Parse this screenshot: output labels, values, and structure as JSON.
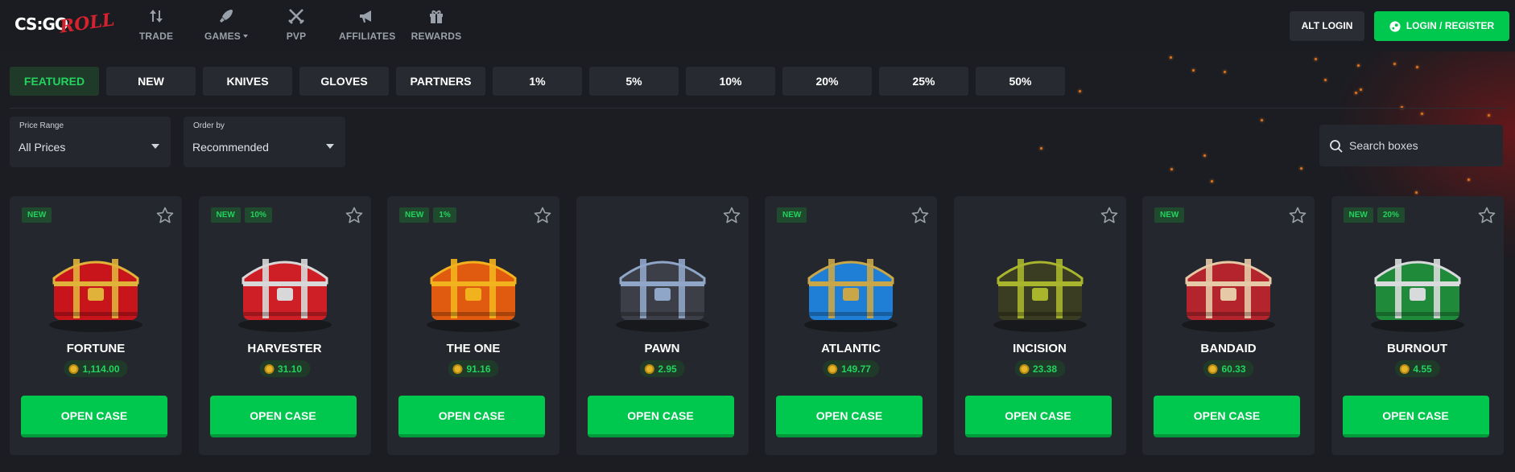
{
  "header": {
    "logo_text": "CS:GO",
    "logo_accent": "ROLL",
    "nav": [
      {
        "label": "TRADE",
        "icon": "arrows-up-down-icon"
      },
      {
        "label": "GAMES",
        "icon": "rocket-icon",
        "has_dropdown": true
      },
      {
        "label": "PVP",
        "icon": "crossed-swords-icon"
      },
      {
        "label": "AFFILIATES",
        "icon": "megaphone-icon"
      },
      {
        "label": "REWARDS",
        "icon": "gift-icon"
      }
    ],
    "alt_login_label": "ALT LOGIN",
    "login_label": "LOGIN / REGISTER"
  },
  "tabs": [
    {
      "label": "FEATURED",
      "active": true
    },
    {
      "label": "NEW"
    },
    {
      "label": "KNIVES"
    },
    {
      "label": "GLOVES"
    },
    {
      "label": "PARTNERS"
    },
    {
      "label": "1%"
    },
    {
      "label": "5%"
    },
    {
      "label": "10%"
    },
    {
      "label": "20%"
    },
    {
      "label": "25%"
    },
    {
      "label": "50%"
    }
  ],
  "filters": {
    "price_range": {
      "label": "Price Range",
      "value": "All Prices"
    },
    "order_by": {
      "label": "Order by",
      "value": "Recommended"
    },
    "search": {
      "placeholder": "Search boxes"
    }
  },
  "cases": [
    {
      "name": "FORTUNE",
      "price": "1,114.00",
      "badges": [
        "NEW"
      ],
      "colors": [
        "#c8141b",
        "#e0b23a"
      ]
    },
    {
      "name": "HARVESTER",
      "price": "31.10",
      "badges": [
        "NEW",
        "10%"
      ],
      "colors": [
        "#cf1f26",
        "#d8d8d8"
      ]
    },
    {
      "name": "THE ONE",
      "price": "91.16",
      "badges": [
        "NEW",
        "1%"
      ],
      "colors": [
        "#e05a10",
        "#f2b21e"
      ]
    },
    {
      "name": "PAWN",
      "price": "2.95",
      "badges": [],
      "colors": [
        "#3c3f47",
        "#8fa6c8"
      ]
    },
    {
      "name": "ATLANTIC",
      "price": "149.77",
      "badges": [
        "NEW"
      ],
      "colors": [
        "#1f7fd6",
        "#c9a648"
      ]
    },
    {
      "name": "INCISION",
      "price": "23.38",
      "badges": [],
      "colors": [
        "#3a3d22",
        "#a9b52c"
      ]
    },
    {
      "name": "BANDAID",
      "price": "60.33",
      "badges": [
        "NEW"
      ],
      "colors": [
        "#b3242c",
        "#e6c9a6"
      ]
    },
    {
      "name": "BURNOUT",
      "price": "4.55",
      "badges": [
        "NEW",
        "20%"
      ],
      "colors": [
        "#1f8a3a",
        "#d8dadc"
      ]
    }
  ],
  "open_label": "OPEN CASE",
  "colors": {
    "accent_green": "#00c74d",
    "badge_text": "#22d35e",
    "background": "#1b1d22",
    "card": "#24272d"
  }
}
